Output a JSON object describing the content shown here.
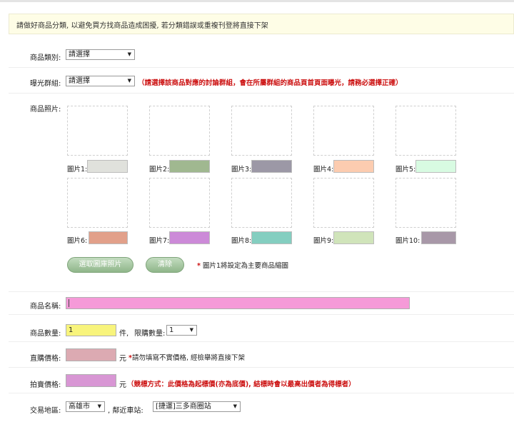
{
  "notice": "請做好商品分類, 以避免買方找商品造成困擾, 若分類錯誤或重複刊登將直接下架",
  "category": {
    "label": "商品類別:",
    "value": "請選擇"
  },
  "exposure": {
    "label": "曝光群組:",
    "value": "請選擇",
    "warning": "（請選擇該商品對應的討論群組，會在所屬群組的商品頁首頁面曝光，請務必選擇正確）"
  },
  "photos": {
    "label": "商品照片:",
    "items": [
      {
        "label": "圖片1:",
        "color": "#e0e1dc"
      },
      {
        "label": "圖片2:",
        "color": "#a0b890"
      },
      {
        "label": "圖片3:",
        "color": "#9c98a6"
      },
      {
        "label": "圖片4:",
        "color": "#fcccb0"
      },
      {
        "label": "圖片5:",
        "color": "#d8fbe2"
      },
      {
        "label": "圖片6:",
        "color": "#e2a08a"
      },
      {
        "label": "圖片7:",
        "color": "#cc8ad8"
      },
      {
        "label": "圖片8:",
        "color": "#84cec0"
      },
      {
        "label": "圖片9:",
        "color": "#d0e4ba"
      },
      {
        "label": "圖片10:",
        "color": "#a898a8"
      }
    ],
    "select_button": "選取圖庫照片",
    "clear_button": "清除",
    "star": "*",
    "note": "圖片1將設定為主要商品縮圖"
  },
  "name": {
    "label": "商品名稱:",
    "color": "#f59ad8"
  },
  "quantity": {
    "label": "商品數量:",
    "value": "1",
    "color": "#f8f47c",
    "unit": "件,",
    "limit_label": "限購數量:",
    "limit_value": "1"
  },
  "direct_price": {
    "label": "直購價格:",
    "color": "#dcaab2",
    "unit": "元",
    "star": "*",
    "note": "請勿填寫不實價格, 經檢舉將直接下架"
  },
  "auction_price": {
    "label": "拍賣價格:",
    "color": "#d896d4",
    "unit": "元",
    "note": "（競標方式：此價格為起標價(亦為底價), 結標時會以最高出價者為得標者）"
  },
  "location": {
    "label": "交易地區:",
    "city": "高雄市",
    "station_label": ", 鄰近車站:",
    "station": "[捷運]三多商圈站"
  }
}
